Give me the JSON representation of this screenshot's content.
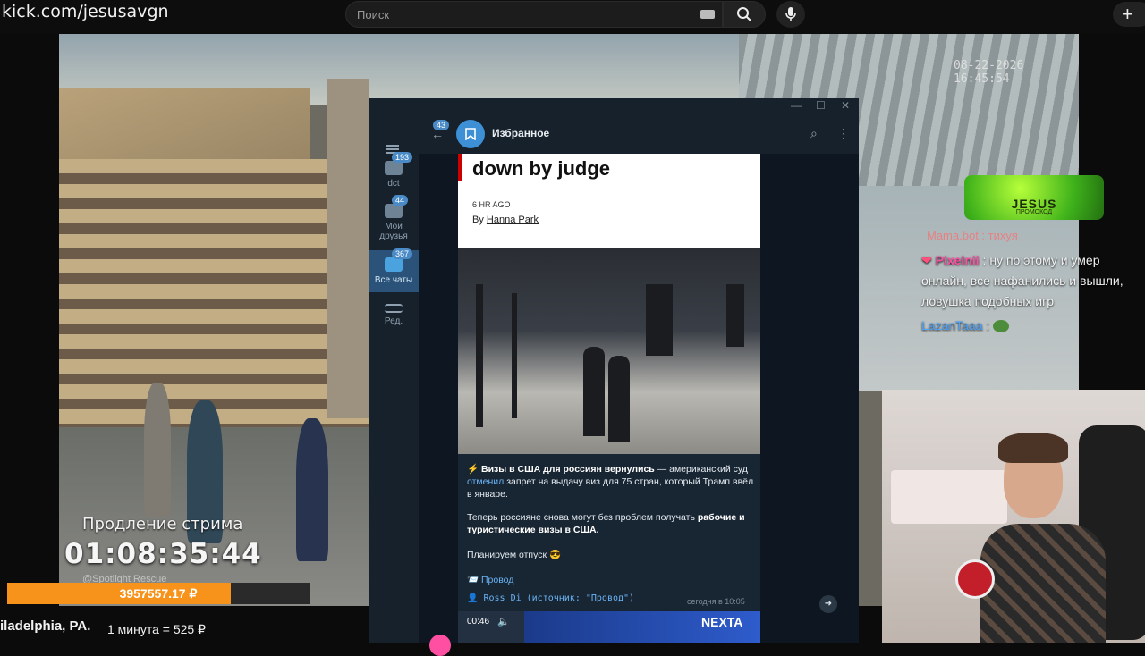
{
  "browser": {
    "url": "kick.com/jesusavgn",
    "search_placeholder": "Поиск"
  },
  "stream": {
    "camera_timestamp": "08-22-2026 16:45:54",
    "extension_label": "Продление стрима",
    "extension_timer": "01:08:35:44",
    "watermark": "@Spotlight Rescue",
    "donation_amount": "3957557.17 ₽",
    "donation_progress": 0.74,
    "location": "iladelphia, PA.",
    "rate": "1 минута = 525 ₽"
  },
  "promo": {
    "title": "JESUS",
    "subtitle": "ПРОМОКОД"
  },
  "chat": {
    "top_line": "Mama.bot : тихуя",
    "messages": [
      {
        "user": "Pixelnii",
        "text": ": ну по этому и умер онлайн, все нафанились и вышли, ловушка подобных игр"
      },
      {
        "user": "LazanTaaa",
        "text": ":"
      }
    ]
  },
  "telegram": {
    "chat_title": "Избранное",
    "back_badge": "43",
    "sidebar": [
      {
        "label": "dct",
        "badge": "193"
      },
      {
        "label": "Мои друзья",
        "badge": "44"
      },
      {
        "label": "Все чаты",
        "badge": "367"
      },
      {
        "label": "Ред.",
        "badge": ""
      }
    ],
    "article": {
      "title": "down by judge",
      "time": "6 HR AGO",
      "by_prefix": "By",
      "author": "Hanna Park"
    },
    "post": {
      "headline": "⚡ Визы в США для россиян вернулись",
      "p1_a": " — американский суд ",
      "p1_link": "отменил",
      "p1_b": " запрет на выдачу виз для 75 стран, который Трамп ввёл в январе.",
      "p2_a": "Теперь россияне снова могут без проблем получать ",
      "p2_bold": "рабочие и туристические визы в США.",
      "p3": "Планируем отпуск 😎",
      "source_link": "📨 Провод",
      "author_line": "👤 Ross Di (источник: \"Провод\")",
      "time": "сегодня в 10:05"
    },
    "video": {
      "duration": "00:46",
      "channel": "NEXTA"
    }
  }
}
